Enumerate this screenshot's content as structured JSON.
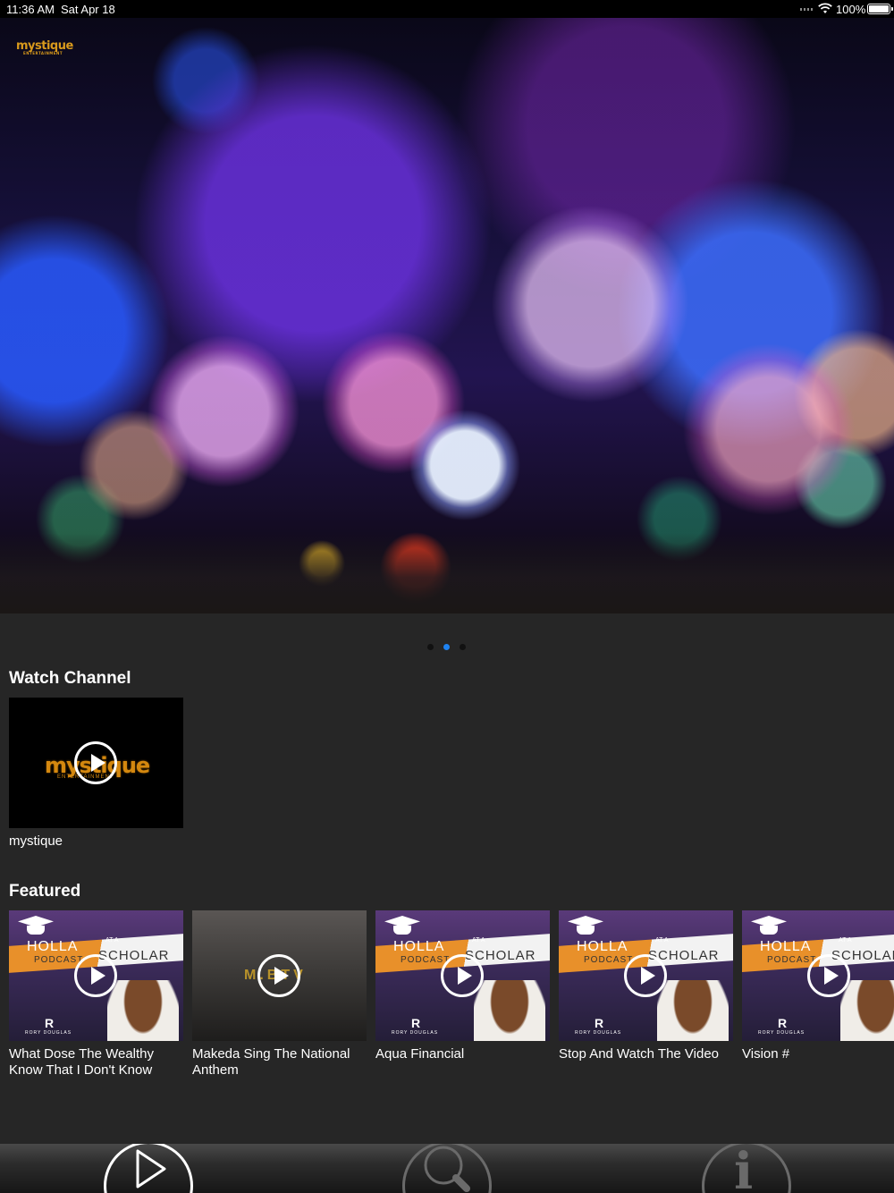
{
  "status_bar": {
    "time": "11:36 AM",
    "date": "Sat Apr 18",
    "battery": "100%"
  },
  "hero": {
    "logo": "mystique",
    "logo_sub": "ENTERTAINMENT",
    "slide_count": 3,
    "active_slide": 2
  },
  "watch_channel": {
    "title": "Watch Channel",
    "items": [
      {
        "caption": "mystique",
        "thumb_logo": "mystique",
        "thumb_logo_sub": "ENTERTAINMENT"
      }
    ]
  },
  "featured": {
    "title": "Featured",
    "thumb_text": {
      "holla": "HOLLA",
      "at_a": "AT A",
      "scholar": "SCHOLAR",
      "podcast": "PODCAST",
      "rd_mark": "R",
      "rd_name": "RORY DOUGLAS",
      "mtv": "M.BTV"
    },
    "items": [
      {
        "caption": "What Dose The Wealthy Know That I Don't Know",
        "thumb": "holla-at-a-scholar"
      },
      {
        "caption": "Makeda Sing The National Anthem",
        "thumb": "mbtv"
      },
      {
        "caption": "Aqua Financial",
        "thumb": "holla-at-a-scholar"
      },
      {
        "caption": "Stop And Watch The Video",
        "thumb": "holla-at-a-scholar"
      },
      {
        "caption": "Vision #",
        "thumb": "holla-at-a-scholar"
      }
    ]
  },
  "tab_bar": {
    "tabs": [
      {
        "icon": "play-icon",
        "active": true
      },
      {
        "icon": "search-icon",
        "active": false
      },
      {
        "icon": "info-icon",
        "active": false
      }
    ],
    "info_glyph": "i"
  },
  "colors": {
    "accent": "#1e82f0",
    "background": "#262626",
    "brand_gold": "#d4880f"
  }
}
